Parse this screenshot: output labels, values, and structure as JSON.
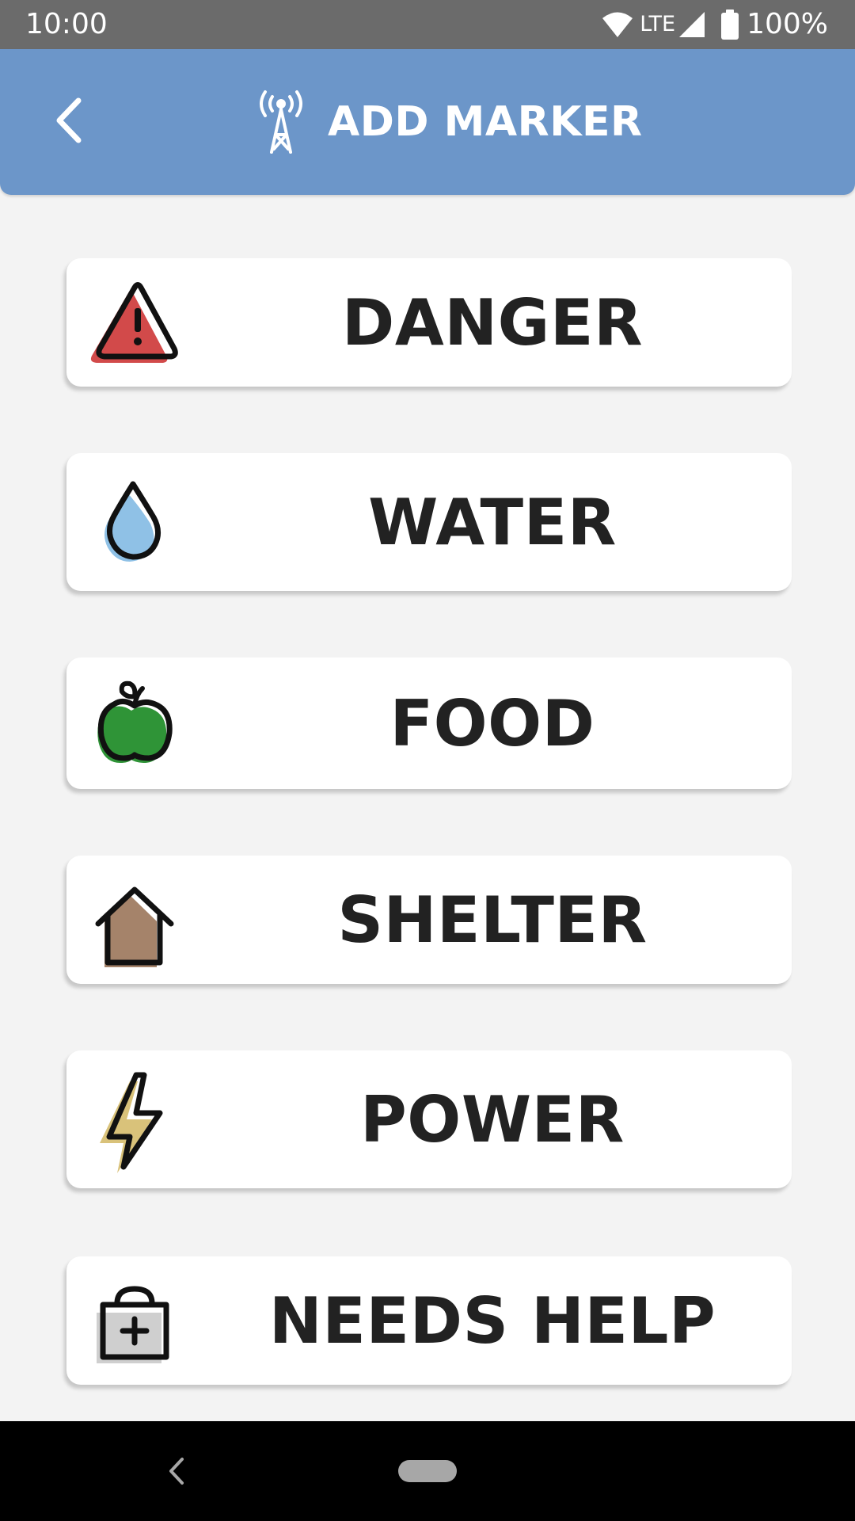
{
  "status_bar": {
    "time": "10:00",
    "network": "LTE",
    "battery": "100%",
    "icons": [
      "wifi-icon",
      "signal-icon",
      "battery-icon"
    ]
  },
  "app_bar": {
    "title": "ADD MARKER",
    "back_icon": "chevron-left-icon",
    "title_icon": "radio-tower-icon",
    "background_color": "#6c96c9"
  },
  "markers": [
    {
      "label": "DANGER",
      "icon": "warning-triangle-icon",
      "color": "#d24a4a"
    },
    {
      "label": "WATER",
      "icon": "water-drop-icon",
      "color": "#8fc1e6"
    },
    {
      "label": "FOOD",
      "icon": "apple-icon",
      "color": "#2f9437"
    },
    {
      "label": "SHELTER",
      "icon": "house-icon",
      "color": "#a5836a"
    },
    {
      "label": "POWER",
      "icon": "lightning-bolt-icon",
      "color": "#d9c27a"
    },
    {
      "label": "NEEDS HELP",
      "icon": "medical-kit-icon",
      "color": "#cfcfcf"
    }
  ],
  "nav_bar": {
    "icons": [
      "nav-back-icon",
      "home-pill-icon"
    ]
  }
}
